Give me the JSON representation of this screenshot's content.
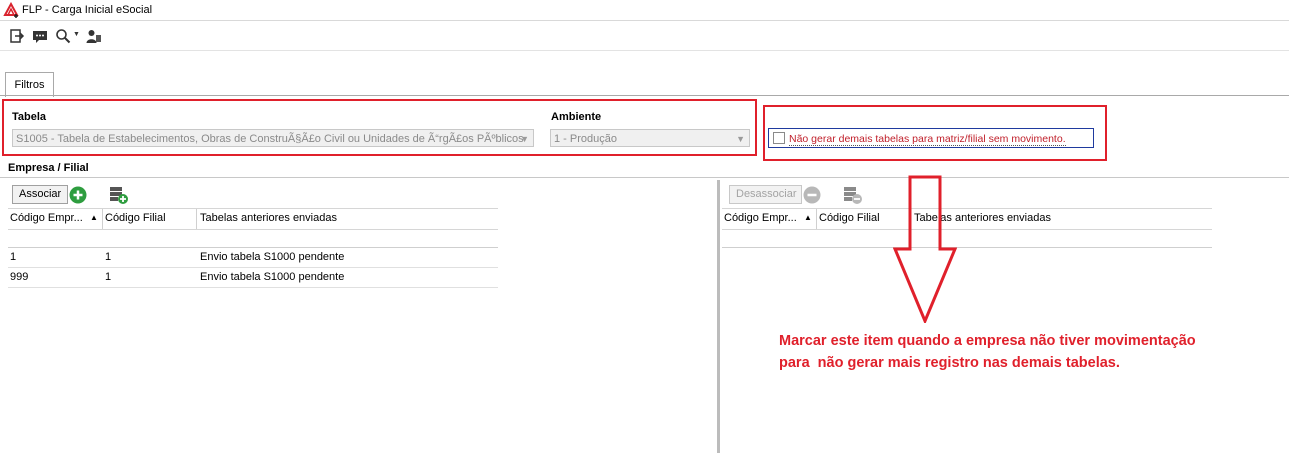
{
  "window": {
    "title": "FLP - Carga Inicial eSocial"
  },
  "toolbar": {
    "icons": [
      "exit-icon",
      "message-icon",
      "search-icon",
      "user-icon"
    ]
  },
  "tabs": [
    {
      "label": "Filtros"
    }
  ],
  "filters": {
    "tabela_label": "Tabela",
    "tabela_value": "S1005 - Tabela de Estabelecimentos, Obras de ConstruÃ§Ã£o Civil ou Unidades de Ã“rgÃ£os PÃºblicos",
    "ambiente_label": "Ambiente",
    "ambiente_value": "1 - Produção",
    "checkbox_label": "Não gerar demais tabelas para matriz/filial sem movimento.",
    "checkbox_checked": false
  },
  "empresa": {
    "section_title": "Empresa / Filial",
    "associar_label": "Associar",
    "desassociar_label": "Desassociar",
    "columns": [
      "Código Empr...",
      "Código Filial",
      "Tabelas anteriores enviadas"
    ],
    "left_rows": [
      {
        "empresa": "1",
        "filial": "1",
        "tabelas": "Envio tabela S1000 pendente"
      },
      {
        "empresa": "999",
        "filial": "1",
        "tabelas": "Envio tabela S1000 pendente"
      }
    ]
  },
  "annotation": {
    "line1": "Marcar este item quando a empresa não tiver movimentação",
    "line2": "para  não gerar mais registro nas demais tabelas."
  },
  "colors": {
    "highlight_red": "#e0202b",
    "checkbox_border": "#1f3a9e"
  }
}
